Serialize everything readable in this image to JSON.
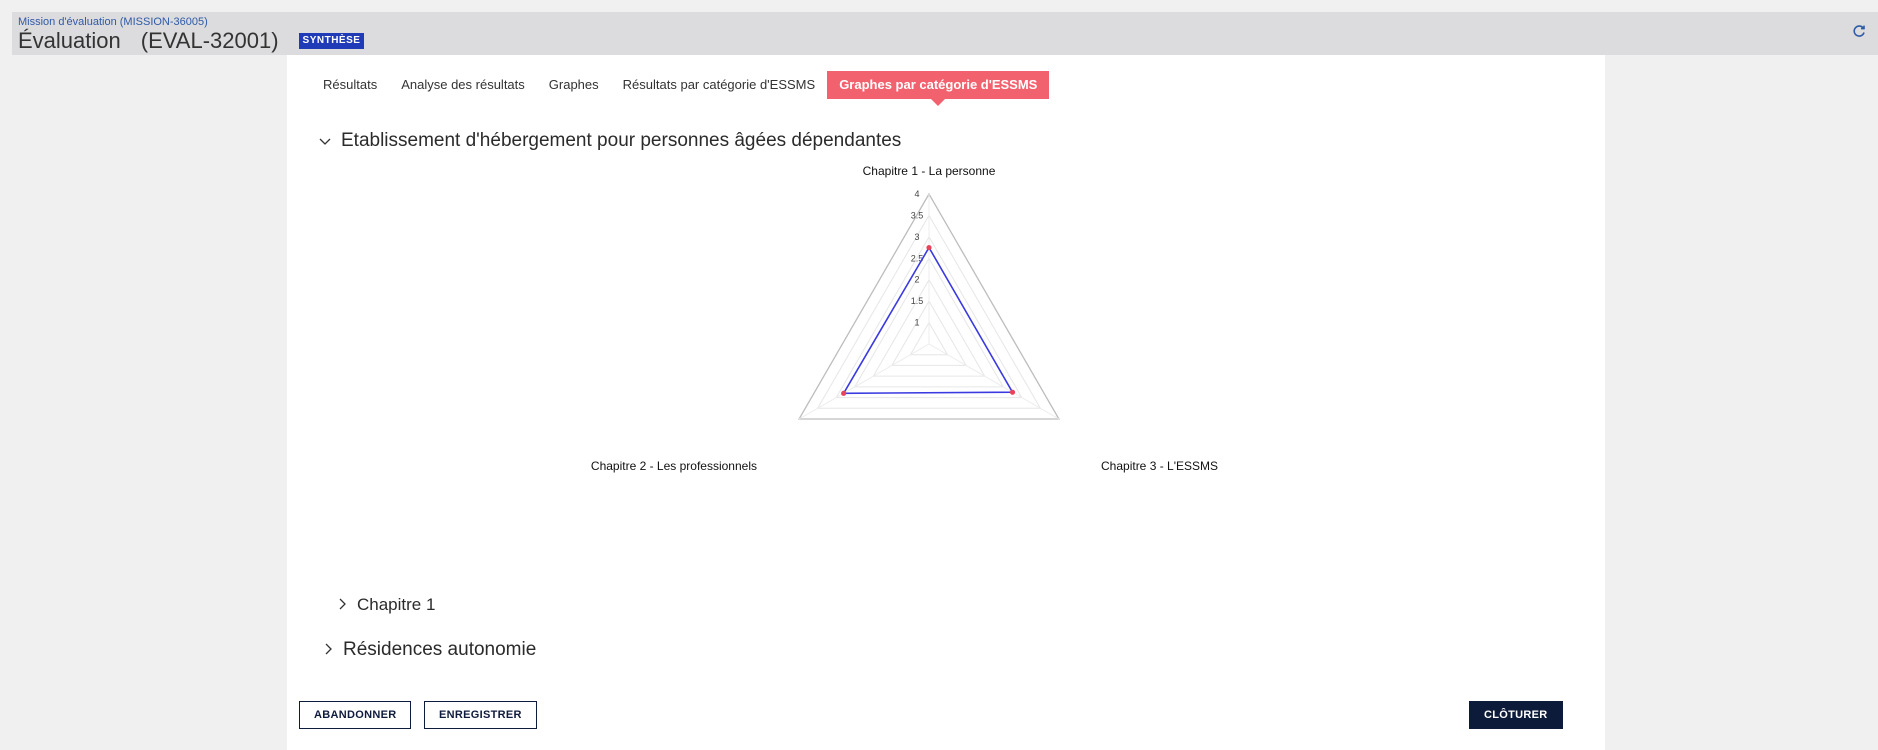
{
  "header": {
    "mission_link": "Mission d'évaluation (MISSION-36005)",
    "title": "Évaluation",
    "code": "(EVAL-32001)",
    "badge": "SYNTHÈSE",
    "refresh_glyph": "C"
  },
  "tabs": [
    {
      "label": "Résultats",
      "active": false
    },
    {
      "label": "Analyse des résultats",
      "active": false
    },
    {
      "label": "Graphes",
      "active": false
    },
    {
      "label": "Résultats par catégorie d'ESSMS",
      "active": false
    },
    {
      "label": "Graphes par catégorie d'ESSMS",
      "active": true
    }
  ],
  "section": {
    "title": "Etablissement d'hébergement pour personnes âgées dépendantes",
    "expanded": true,
    "chevron": "﹀"
  },
  "chart_data": {
    "type": "radar",
    "axes": [
      "Chapitre 1 - La personne",
      "Chapitre 2 - Les professionnels",
      "Chapitre 3 - L'ESSMS"
    ],
    "scale_ticks": [
      "1",
      "1.5",
      "2",
      "2.5",
      "3",
      "3.5",
      "4"
    ],
    "range": [
      0.5,
      4
    ],
    "values": [
      2.75,
      2.8,
      2.75
    ],
    "colors": {
      "line": "#3a3ae0",
      "point": "#e8435a",
      "grid": "#cfcfcf"
    }
  },
  "subsections": [
    {
      "title": "Chapitre 1",
      "chevron": "›"
    },
    {
      "title": "Résidences autonomie",
      "chevron": "›"
    }
  ],
  "buttons": {
    "abandon": "ABANDONNER",
    "save": "ENREGISTRER",
    "close": "CLÔTURER"
  }
}
